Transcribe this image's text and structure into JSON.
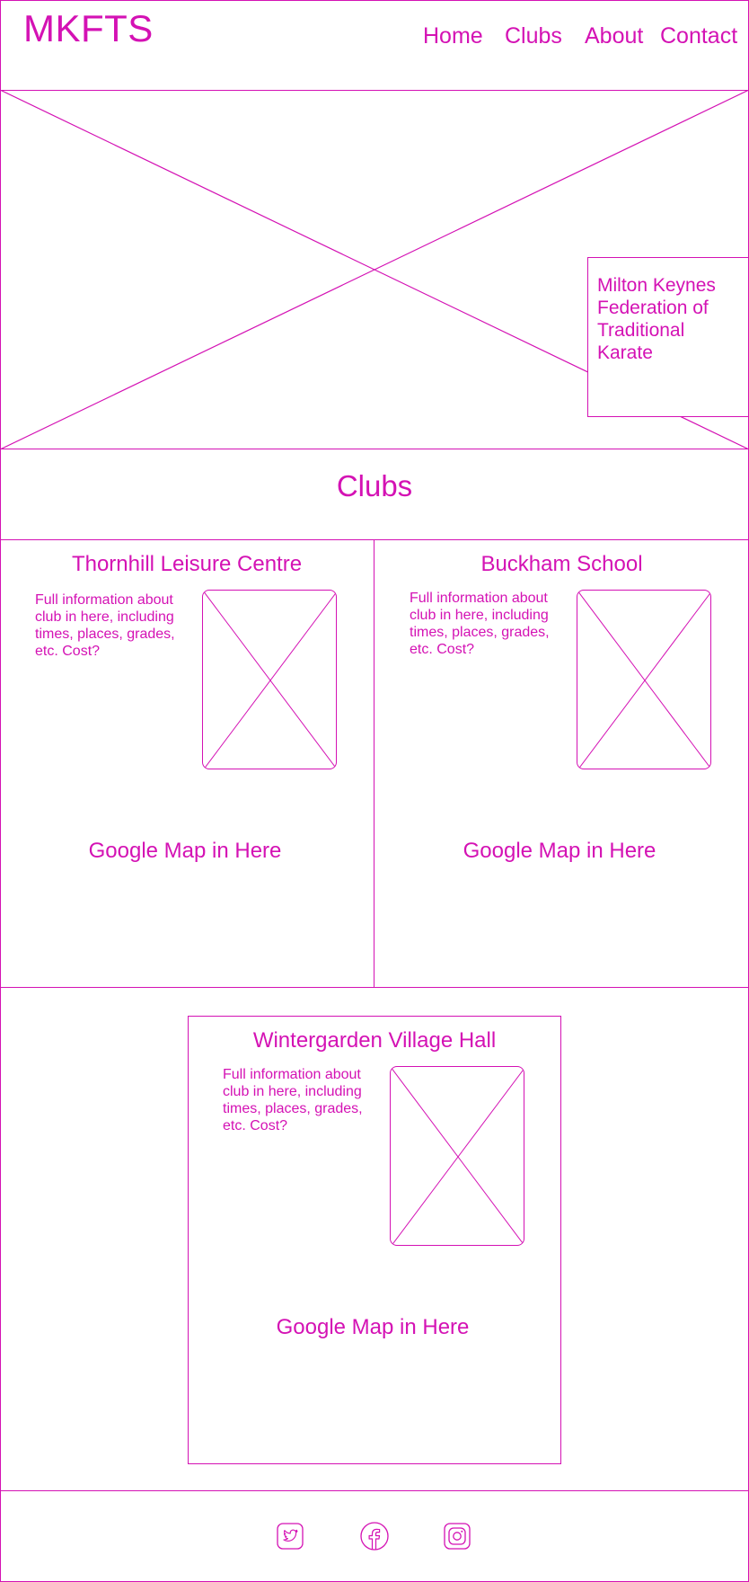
{
  "header": {
    "logo": "MKFTS",
    "nav": [
      "Home",
      "Clubs",
      "About",
      "Contact"
    ]
  },
  "hero": {
    "caption": "Milton Keynes Federation of Traditional Karate"
  },
  "clubs": {
    "title": "Clubs",
    "items": [
      {
        "name": "Thornhill Leisure Centre",
        "info": "Full information about club in here, including times, places, grades, etc. Cost?",
        "map": "Google Map in Here"
      },
      {
        "name": "Buckham School",
        "info": "Full information about club in here, including times, places, grades, etc. Cost?",
        "map": "Google Map in Here"
      },
      {
        "name": "Wintergarden Village Hall",
        "info": "Full information about club in here, including times, places, grades, etc. Cost?",
        "map": "Google Map in Here"
      }
    ]
  },
  "footer": {
    "icons": [
      "twitter-icon",
      "facebook-icon",
      "instagram-icon"
    ]
  },
  "theme": {
    "accent": "#d412b4",
    "background": "#ffffff"
  }
}
